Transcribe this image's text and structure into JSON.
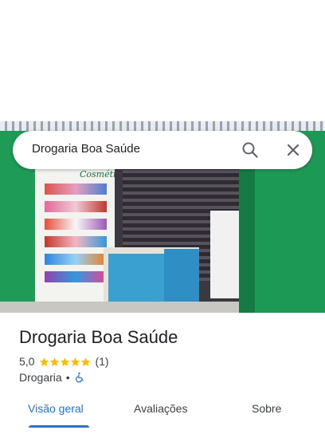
{
  "search": {
    "query": "Drogaria Boa Saúde",
    "search_icon": "search-icon",
    "close_icon": "close-icon"
  },
  "photo": {
    "sign_text": "Cosméti"
  },
  "place": {
    "title": "Drogaria Boa Saúde",
    "rating": "5,0",
    "stars": 5,
    "review_count": "(1)",
    "category": "Drogaria",
    "separator": "•",
    "accessibility_icon": "wheelchair-icon"
  },
  "tabs": [
    {
      "label": "Visão geral",
      "selected": true
    },
    {
      "label": "Avaliações",
      "selected": false
    },
    {
      "label": "Sobre",
      "selected": false
    }
  ],
  "colors": {
    "accent": "#1a73e8",
    "star": "#fbbc04",
    "text": "#202124"
  }
}
